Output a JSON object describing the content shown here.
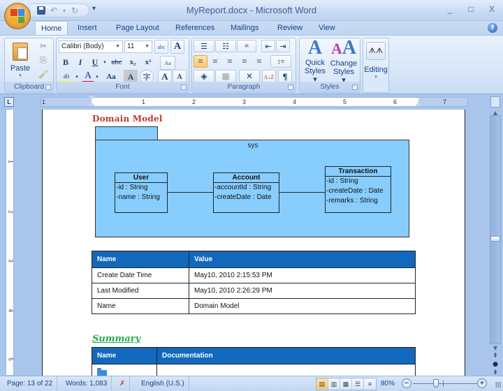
{
  "window": {
    "title": "MyReport.docx - Microsoft Word",
    "controls": {
      "minimize": "_",
      "maximize": "□",
      "close": "X"
    },
    "quick_access": {
      "save": "save-icon",
      "undo": "↶",
      "undo_dropdown": "▾",
      "redo": "↻",
      "customize": "▾"
    }
  },
  "tabs": [
    {
      "label": "Home",
      "active": true
    },
    {
      "label": "Insert"
    },
    {
      "label": "Page Layout"
    },
    {
      "label": "References"
    },
    {
      "label": "Mailings"
    },
    {
      "label": "Review"
    },
    {
      "label": "View"
    }
  ],
  "help_label": "?",
  "ribbon": {
    "clipboard": {
      "label": "Clipboard",
      "paste": "Paste",
      "cut": "✂",
      "copy": "⎘",
      "format_painter": "🖌"
    },
    "font": {
      "label": "Font",
      "font_name": "Calibri (Body)",
      "font_size": "11",
      "clear_formatting": "abc",
      "char_shading_box": "A",
      "bold": "B",
      "italic": "I",
      "underline": "U",
      "strikethrough": "abc",
      "subscript": "x₂",
      "superscript": "x²",
      "change_case_clear": "Aa",
      "highlight": "ab",
      "font_color": "A",
      "change_case": "Aa",
      "char_shading": "A",
      "enclose": "字",
      "grow_font": "A",
      "shrink_font": "A",
      "highlight_color": "#ffff00",
      "font_color_value": "#e81123"
    },
    "paragraph": {
      "label": "Paragraph",
      "bullets": "☰",
      "numbering": "☷",
      "multilevel": "≡",
      "decrease_indent": "⇤",
      "increase_indent": "⇥",
      "align_left": "≡",
      "center": "≡",
      "align_right": "≡",
      "justify": "≡",
      "distributed": "≡",
      "line_spacing": "↕≡",
      "shading": "◈",
      "borders": "▦",
      "asian_layout": "✕",
      "sort": "A↓Z",
      "show_marks": "¶"
    },
    "styles": {
      "label": "Styles",
      "quick_styles": [
        "Quick",
        "Styles ▾"
      ],
      "change_styles": [
        "Change",
        "Styles ▾"
      ]
    },
    "editing": {
      "label": "Editing",
      "arrow": "▾"
    }
  },
  "ruler": {
    "corner": "L",
    "numbers": [
      "1",
      "1",
      "2",
      "3",
      "4",
      "5",
      "6",
      "7"
    ]
  },
  "vruler": {
    "numbers": [
      "1",
      "2",
      "3",
      "4",
      "5"
    ]
  },
  "document": {
    "heading_domain_model": "Domain Model",
    "diagram": {
      "package_name": "sys",
      "classes": [
        {
          "name": "User",
          "attributes": [
            "-id : String",
            "-name : String"
          ]
        },
        {
          "name": "Account",
          "attributes": [
            "-accountId : String",
            "-createDate : Date"
          ]
        },
        {
          "name": "Transaction",
          "attributes": [
            "-id : String",
            "-createDate : Date",
            "-remarks : String"
          ]
        }
      ],
      "fill_color": "#87ceff"
    },
    "properties_table": {
      "headers": [
        "Name",
        "Value"
      ],
      "rows": [
        [
          "Create Date Time",
          "May10, 2010 2:15:53 PM"
        ],
        [
          "Last Modified",
          "May10, 2010 2:26:29 PM"
        ],
        [
          "Name",
          "Domain Model"
        ]
      ],
      "header_color": "#1268bd"
    },
    "heading_summary": "Summary",
    "summary_table": {
      "headers": [
        "Name",
        "Documentation"
      ],
      "rows": [
        [
          "folder-icon",
          ""
        ]
      ]
    }
  },
  "statusbar": {
    "page": "Page: 13 of 22",
    "words": "Words: 1,083",
    "proofing_icon": "proofing-error-icon",
    "language": "English (U.S.)",
    "zoom": "80%",
    "zoom_level_percent": 80,
    "zoom_out": "−",
    "zoom_in": "+"
  }
}
